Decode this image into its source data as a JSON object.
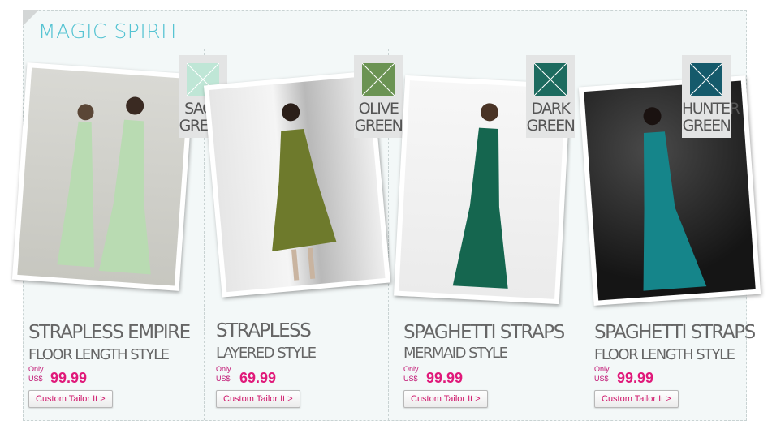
{
  "section_title": "MAGIC SPIRIT",
  "products": [
    {
      "color_name_line1": "SAGE",
      "color_name_line2": "GREEN",
      "swatch_color": "#bfe6d6",
      "dress_color": "#b9dbb2",
      "name_line1": "STRAPLESS EMPIRE",
      "name_line2": "FLOOR LENGTH STYLE",
      "only_label": "Only",
      "currency": "US$",
      "price": "99.99",
      "button_label": "Custom Tailor It >"
    },
    {
      "color_name_line1": "OLIVE",
      "color_name_line2": "GREEN",
      "swatch_color": "#6b9353",
      "dress_color": "#6e7a2c",
      "name_line1": "STRAPLESS",
      "name_line2": "LAYERED STYLE",
      "only_label": "Only",
      "currency": "US$",
      "price": "69.99",
      "button_label": "Custom Tailor It >"
    },
    {
      "color_name_line1": "DARK",
      "color_name_line2": "GREEN",
      "swatch_color": "#1d6b5f",
      "dress_color": "#15664f",
      "name_line1": "SPAGHETTI STRAPS",
      "name_line2": "MERMAID STYLE",
      "only_label": "Only",
      "currency": "US$",
      "price": "99.99",
      "button_label": "Custom Tailor It >"
    },
    {
      "color_name_line1": "HUNTER",
      "color_name_line2": "GREEN",
      "swatch_color": "#155a6b",
      "dress_color": "#15858a",
      "name_line1": "SPAGHETTI STRAPS",
      "name_line2": "FLOOR LENGTH STYLE",
      "only_label": "Only",
      "currency": "US$",
      "price": "99.99",
      "button_label": "Custom Tailor It >"
    }
  ]
}
